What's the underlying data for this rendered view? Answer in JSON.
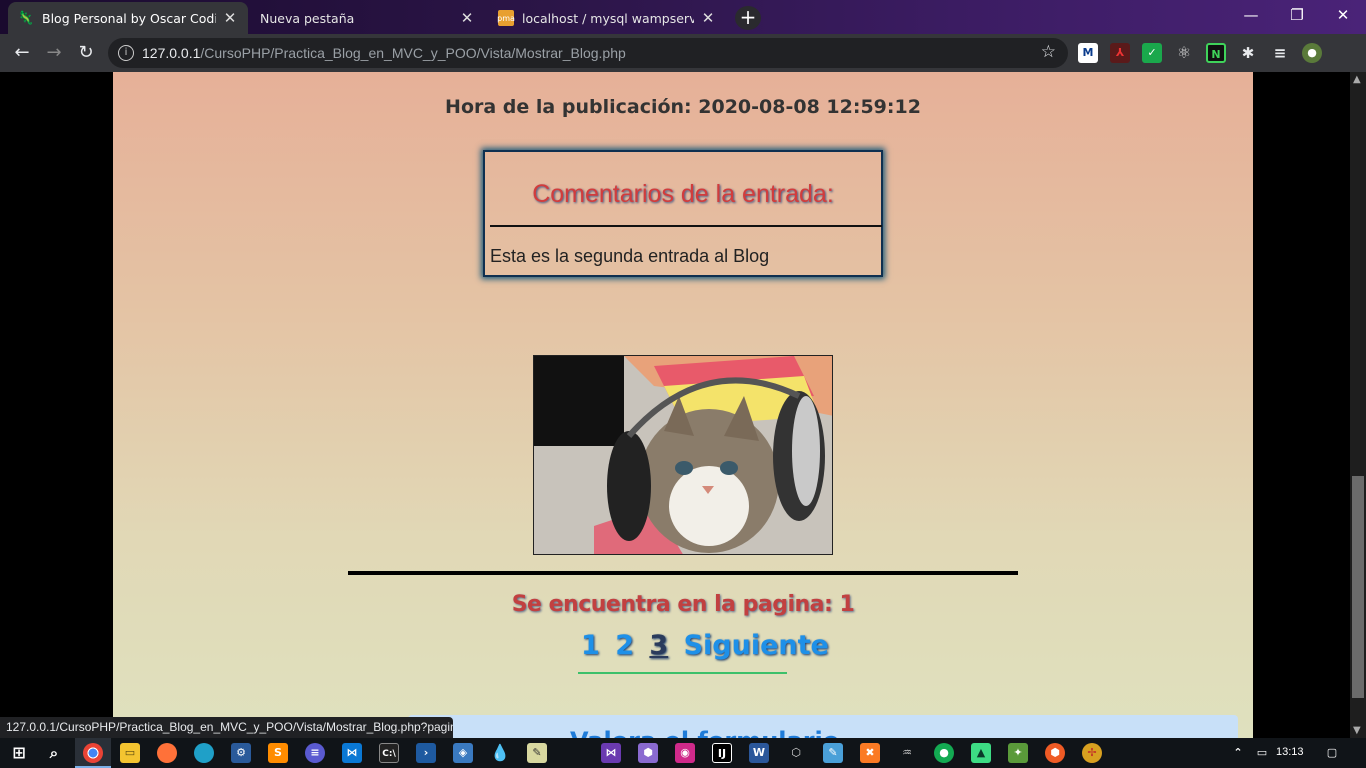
{
  "browser": {
    "tabs": [
      {
        "title": "Blog Personal by Oscar Coding®",
        "active": true
      },
      {
        "title": "Nueva pestaña",
        "active": false
      },
      {
        "title": "localhost / mysql wampserver / b",
        "active": false
      }
    ],
    "url_host": "127.0.0.1",
    "url_path": "/CursoPHP/Practica_Blog_en_MVC_y_POO/Vista/Mostrar_Blog.php",
    "status_url": "127.0.0.1/CursoPHP/Practica_Blog_en_MVC_y_POO/Vista/Mostrar_Blog.php?pagin..."
  },
  "blog": {
    "pub_time": "Hora de la publicación: 2020-08-08 12:59:12",
    "comments_title": "Comentarios de la entrada:",
    "comment_text": "Esta es la segunda entrada al Blog",
    "page_info": "Se encuentra en la pagina: 1",
    "pager": [
      "1",
      "2",
      "3",
      "Siguiente"
    ],
    "subscribe_title": "Valora el formulario"
  },
  "taskbar": {
    "time": "13:13"
  },
  "colors": {
    "page_top": "#e6b098",
    "page_bottom": "#dfe1be",
    "heading_red": "#d23c3c",
    "link_blue": "#1e90e8"
  }
}
